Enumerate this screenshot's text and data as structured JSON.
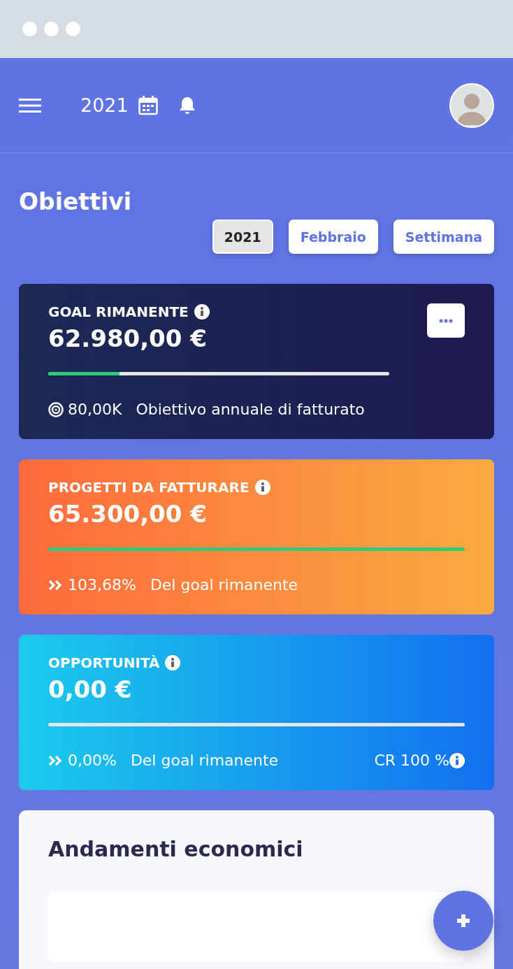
{
  "header": {
    "year": "2021"
  },
  "page_title": "Obiettivi",
  "filters": [
    {
      "label": "2021",
      "selected": true
    },
    {
      "label": "Febbraio",
      "selected": false
    },
    {
      "label": "Settimana",
      "selected": false
    }
  ],
  "cards": [
    {
      "title": "GOAL RIMANENTE",
      "amount": "62.980,00 €",
      "level": 0.21,
      "has_menu": true,
      "kind": "target",
      "footer_value": "80,00K",
      "footer_text": "Obiettivo annuale di fatturato"
    },
    {
      "title": "PROGETTI DA FATTURARE",
      "amount": "65.300,00 €",
      "level": 1.0,
      "has_menu": false,
      "kind": "chevrons",
      "footer_value": "103,68%",
      "footer_text": "Del goal rimanente"
    },
    {
      "title": "OPPORTUNITÀ",
      "amount": "0,00 €",
      "level": 0,
      "has_menu": false,
      "kind": "chevrons",
      "footer_value": "0,00%",
      "footer_text": "Del goal rimanente",
      "footer_extra": "CR 100 %"
    }
  ],
  "section": {
    "title": "Andamenti economici"
  }
}
